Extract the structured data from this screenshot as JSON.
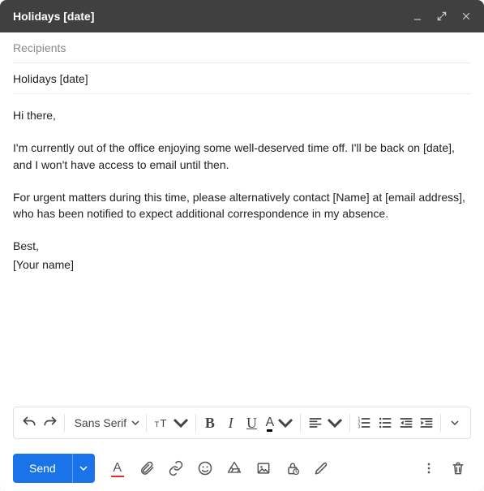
{
  "titlebar": {
    "title": "Holidays [date]"
  },
  "fields": {
    "recipients_placeholder": "Recipients",
    "recipients_value": "",
    "subject_value": "Holidays [date]"
  },
  "body": {
    "greeting": "Hi there,",
    "p1": "I'm currently out of the office enjoying some well-deserved time off. I'll be back on [date], and I won't have access to email until then.",
    "p2": "For urgent matters during this time, please alternatively contact [Name] at [email address], who has been notified to expect additional correspondence in my absence.",
    "closing": "Best,",
    "signature": "[Your name]"
  },
  "format": {
    "font_name": "Sans Serif"
  },
  "actions": {
    "send_label": "Send"
  }
}
